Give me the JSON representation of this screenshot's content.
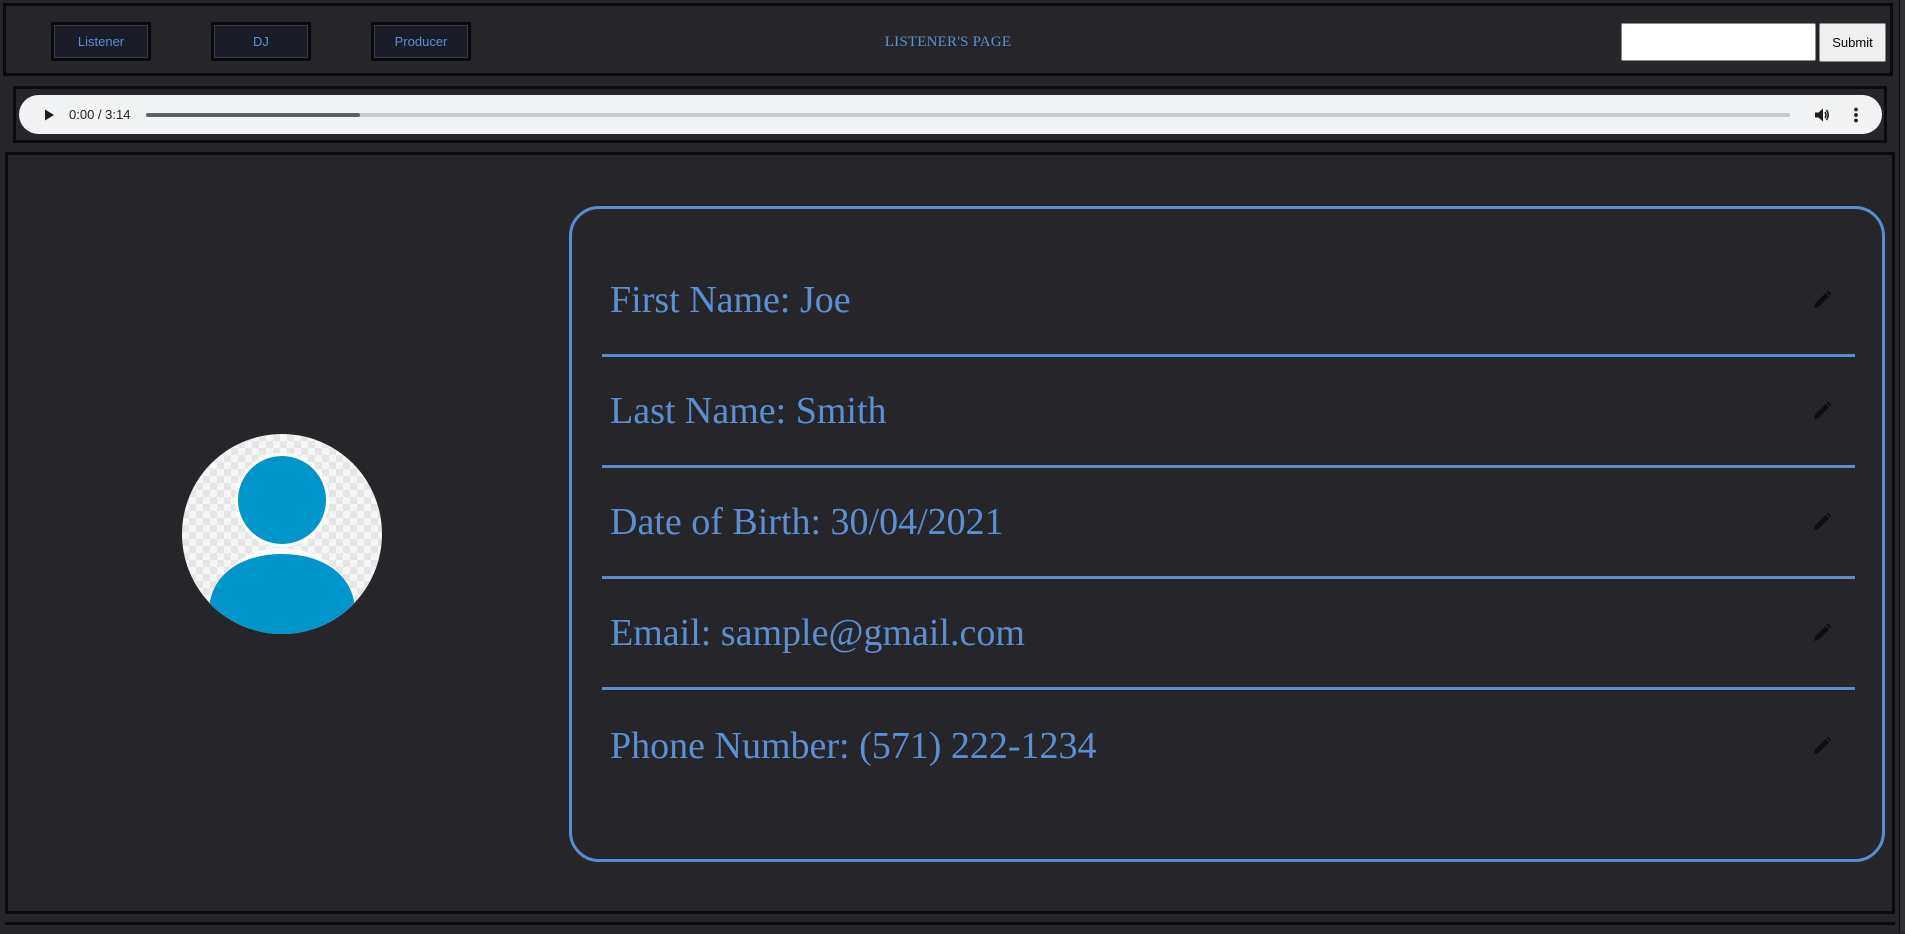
{
  "nav": {
    "buttons": [
      {
        "label": "Listener"
      },
      {
        "label": "DJ"
      },
      {
        "label": "Producer"
      }
    ],
    "title": "LISTENER'S PAGE",
    "search": {
      "value": "",
      "placeholder": ""
    },
    "submit_label": "Submit"
  },
  "audio": {
    "time": "0:00 / 3:14",
    "buffered_fraction": 0.13,
    "icons": [
      "play-icon",
      "volume-icon",
      "more-vert-icon"
    ]
  },
  "profile": {
    "avatar_icon": "user-avatar-icon",
    "fields": [
      {
        "text": "First Name: Joe"
      },
      {
        "text": "Last Name: Smith"
      },
      {
        "text": "Date of Birth: 30/04/2021"
      },
      {
        "text": "Email: sample@gmail.com"
      },
      {
        "text": "Phone Number: (571) 222-1234"
      }
    ],
    "edit_icon": "pencil-icon"
  },
  "colors": {
    "background": "#26262a",
    "accent": "#5b8dce",
    "avatar": "#0096cc"
  }
}
